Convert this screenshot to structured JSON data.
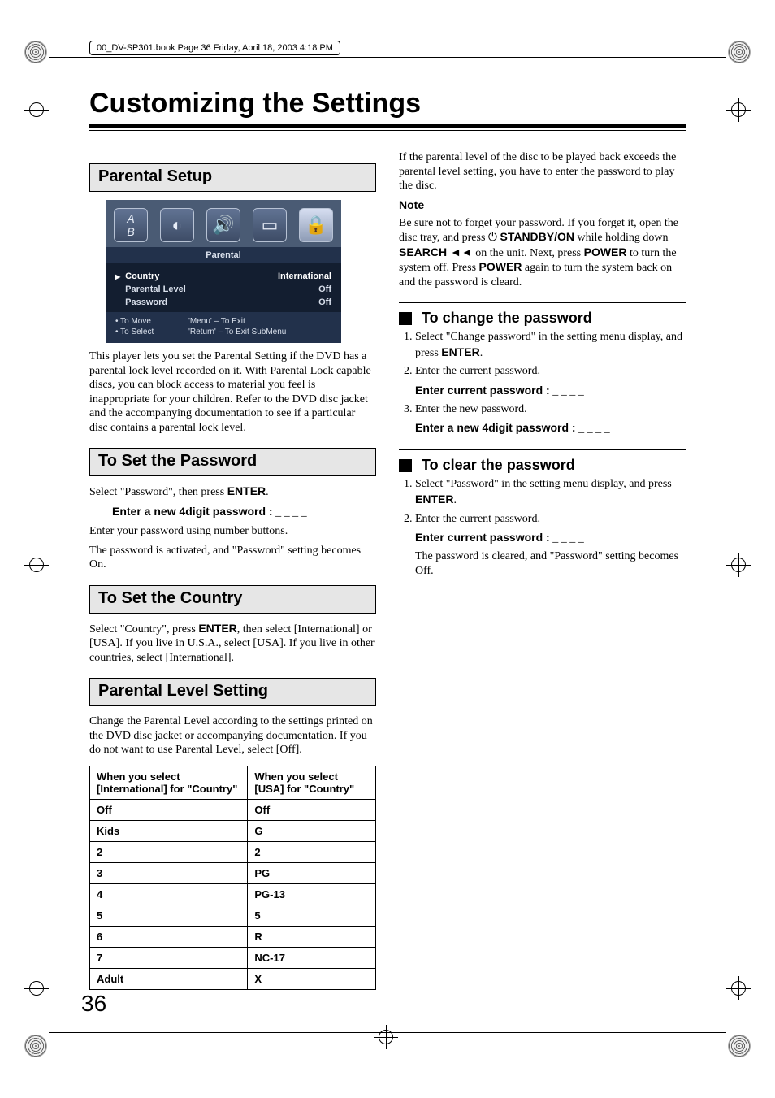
{
  "book_header": "00_DV-SP301.book  Page 36  Friday, April 18, 2003  4:18 PM",
  "page_number": "36",
  "title": "Customizing the Settings",
  "sections": {
    "parental_setup": {
      "heading": "Parental Setup",
      "osd": {
        "icons": [
          "AB",
          "disc",
          "speaker",
          "tv",
          "lock"
        ],
        "label": "Parental",
        "rows": [
          {
            "l": "Country",
            "r": "International",
            "sel": true
          },
          {
            "l": "Parental Level",
            "r": "Off",
            "sel": false
          },
          {
            "l": "Password",
            "r": "Off",
            "sel": false
          }
        ],
        "foot": [
          {
            "k": "To Move",
            "v": "'Menu' – To Exit"
          },
          {
            "k": "To Select",
            "v": "'Return' – To Exit SubMenu"
          }
        ]
      },
      "body": "This player lets you set the Parental Setting if the DVD has a parental lock level recorded on it. With Parental Lock capable discs, you can block access to material you feel is inappropriate for your children. Refer to the DVD disc jacket and the accompanying documentation to see if a particular disc contains a parental lock level."
    },
    "set_password": {
      "heading": "To Set the Password",
      "line1_pre": "Select \"Password\", then press ",
      "line1_bold": "ENTER",
      "line1_post": ".",
      "prompt": "Enter a new 4digit password :",
      "blanks": " _ _ _ _",
      "line2": "Enter your password using number buttons.",
      "line3": "The password is activated, and \"Password\" setting becomes On."
    },
    "set_country": {
      "heading": "To Set the Country",
      "body_pre": "Select \"Country\", press ",
      "body_bold": "ENTER",
      "body_post": ", then select [International] or [USA]. If you live in U.S.A., select [USA]. If you live in other countries, select [International]."
    },
    "parental_level": {
      "heading": "Parental Level Setting",
      "body": "Change the Parental Level according to the settings printed on the DVD disc jacket or accompanying documentation. If you do not want to use Parental Level, select [Off].",
      "table": {
        "head_intl": "When you select [International] for \"Country\"",
        "head_usa": "When you select [USA] for \"Country\"",
        "rows": [
          [
            "Off",
            "Off"
          ],
          [
            "Kids",
            "G"
          ],
          [
            "2",
            "2"
          ],
          [
            "3",
            "PG"
          ],
          [
            "4",
            "PG-13"
          ],
          [
            "5",
            "5"
          ],
          [
            "6",
            "R"
          ],
          [
            "7",
            "NC-17"
          ],
          [
            "Adult",
            "X"
          ]
        ]
      }
    },
    "right_intro": "If the parental level of the disc to be played back exceeds the parental level setting, you have to enter the password to play the disc.",
    "note": {
      "label": "Note",
      "t1": "Be sure not to forget your password. If you forget it, open the disc tray, and press ",
      "b1": "STANDBY/ON",
      "t2": " while holding down ",
      "b2": "SEARCH ◄◄",
      "t3": " on the unit. Next, press ",
      "b3": "POWER",
      "t4": " to turn the system off. Press ",
      "b4": "POWER",
      "t5": " again to turn the system back on and the password is cleard."
    },
    "change_pw": {
      "title": "To change the password",
      "s1_pre": "Select \"Change password\" in the setting menu display, and press ",
      "s1_bold": "ENTER",
      "s1_post": ".",
      "s2": "Enter the current password.",
      "s2_prompt": "Enter current password :",
      "s3": "Enter the new password.",
      "s3_prompt": "Enter a new 4digit password :",
      "blanks": " _ _ _ _"
    },
    "clear_pw": {
      "title": "To clear the password",
      "s1_pre": "Select \"Password\" in the setting menu display, and press ",
      "s1_bold": "ENTER",
      "s1_post": ".",
      "s2": "Enter the current password.",
      "s2_prompt": "Enter current password :",
      "blanks": " _ _ _ _",
      "s2_after": "The password is cleared, and \"Password\" setting becomes Off."
    }
  },
  "chart_data": {
    "type": "table",
    "columns": [
      "When you select [International] for \"Country\"",
      "When you select [USA] for \"Country\""
    ],
    "rows": [
      [
        "Off",
        "Off"
      ],
      [
        "Kids",
        "G"
      ],
      [
        "2",
        "2"
      ],
      [
        "3",
        "PG"
      ],
      [
        "4",
        "PG-13"
      ],
      [
        "5",
        "5"
      ],
      [
        "6",
        "R"
      ],
      [
        "7",
        "NC-17"
      ],
      [
        "Adult",
        "X"
      ]
    ]
  }
}
